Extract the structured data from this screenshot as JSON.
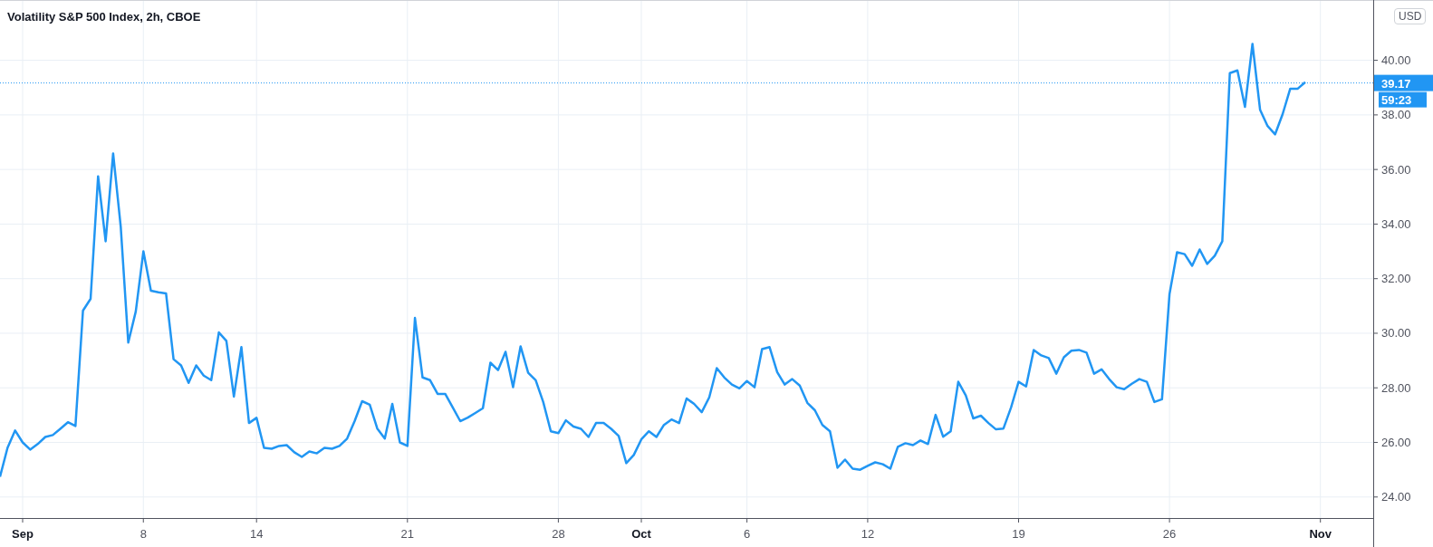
{
  "title": "Volatility S&P 500 Index, 2h, CBOE",
  "currency": "USD",
  "last_price": "39.17",
  "countdown": "59:23",
  "chart_data": {
    "type": "line",
    "grid": true,
    "ylim": [
      23.23,
      42.21
    ],
    "categories": [
      null,
      null,
      null,
      "Sep",
      null,
      null,
      null,
      null,
      null,
      null,
      null,
      null,
      null,
      null,
      null,
      null,
      null,
      null,
      null,
      "8",
      null,
      null,
      null,
      null,
      null,
      null,
      null,
      null,
      null,
      null,
      null,
      null,
      null,
      null,
      "14",
      null,
      null,
      null,
      null,
      null,
      null,
      null,
      null,
      null,
      null,
      null,
      null,
      null,
      null,
      null,
      null,
      null,
      null,
      null,
      "21",
      null,
      null,
      null,
      null,
      null,
      null,
      null,
      null,
      null,
      null,
      null,
      null,
      null,
      null,
      null,
      null,
      null,
      null,
      null,
      "28",
      null,
      null,
      null,
      null,
      null,
      null,
      null,
      null,
      null,
      null,
      "Oct",
      null,
      null,
      null,
      null,
      null,
      null,
      null,
      null,
      null,
      null,
      null,
      null,
      null,
      "6",
      null,
      null,
      null,
      null,
      null,
      null,
      null,
      null,
      null,
      null,
      null,
      null,
      null,
      null,
      null,
      "12",
      null,
      null,
      null,
      null,
      null,
      null,
      null,
      null,
      null,
      null,
      null,
      null,
      null,
      null,
      null,
      null,
      null,
      null,
      null,
      "19",
      null,
      null,
      null,
      null,
      null,
      null,
      null,
      null,
      null,
      null,
      null,
      null,
      null,
      null,
      null,
      null,
      null,
      null,
      null,
      "26",
      null,
      null,
      null,
      null,
      null,
      null,
      null,
      null,
      null,
      null,
      null,
      null,
      null,
      null,
      null,
      null,
      null,
      null,
      null,
      "Nov",
      null,
      null,
      null,
      null,
      null,
      null,
      null
    ],
    "ref_lines": [
      {
        "axis": "y",
        "value": 39.17,
        "color": "#2196f3"
      }
    ],
    "yticks": [
      {
        "value": 24,
        "label": "24.00"
      },
      {
        "value": 26,
        "label": "26.00"
      },
      {
        "value": 28,
        "label": "28.00"
      },
      {
        "value": 30,
        "label": "30.00"
      },
      {
        "value": 32,
        "label": "32.00"
      },
      {
        "value": 34,
        "label": "34.00"
      },
      {
        "value": 36,
        "label": "36.00"
      },
      {
        "value": 38,
        "label": "38.00"
      },
      {
        "value": 40,
        "label": "40.00"
      }
    ],
    "series": [
      {
        "color": "#2196f3",
        "values": [
          24.74,
          25.8,
          26.44,
          26.0,
          25.74,
          25.94,
          26.2,
          26.27,
          26.5,
          26.74,
          26.6,
          30.83,
          31.26,
          35.75,
          33.37,
          36.59,
          33.9,
          29.66,
          30.8,
          33.0,
          31.56,
          31.5,
          31.46,
          29.05,
          28.82,
          28.18,
          28.82,
          28.45,
          28.28,
          30.03,
          29.72,
          27.68,
          29.49,
          26.71,
          26.9,
          25.8,
          25.77,
          25.87,
          25.9,
          25.64,
          25.47,
          25.67,
          25.6,
          25.8,
          25.77,
          25.87,
          26.14,
          26.78,
          27.51,
          27.38,
          26.51,
          26.14,
          27.41,
          26.0,
          25.87,
          30.56,
          28.38,
          28.28,
          27.78,
          27.78,
          27.28,
          26.78,
          26.91,
          27.08,
          27.25,
          28.92,
          28.65,
          29.32,
          28.02,
          29.52,
          28.55,
          28.28,
          27.48,
          26.41,
          26.34,
          26.81,
          26.58,
          26.5,
          26.2,
          26.71,
          26.71,
          26.5,
          26.24,
          25.24,
          25.54,
          26.11,
          26.41,
          26.2,
          26.64,
          26.84,
          26.71,
          27.61,
          27.41,
          27.11,
          27.65,
          28.72,
          28.38,
          28.12,
          27.98,
          28.25,
          28.02,
          29.42,
          29.49,
          28.58,
          28.12,
          28.32,
          28.08,
          27.45,
          27.18,
          26.64,
          26.41,
          25.07,
          25.37,
          25.04,
          25.0,
          25.14,
          25.27,
          25.2,
          25.04,
          25.84,
          25.97,
          25.9,
          26.07,
          25.94,
          27.01,
          26.21,
          26.41,
          28.22,
          27.72,
          26.88,
          26.98,
          26.71,
          26.48,
          26.51,
          27.28,
          28.22,
          28.05,
          29.39,
          29.19,
          29.09,
          28.52,
          29.12,
          29.36,
          29.39,
          29.29,
          28.52,
          28.68,
          28.32,
          28.02,
          27.95,
          28.15,
          28.32,
          28.22,
          27.48,
          27.58,
          31.43,
          32.97,
          32.9,
          32.47,
          33.07,
          32.54,
          32.84,
          33.37,
          39.53,
          39.63,
          38.29,
          40.6,
          38.19,
          37.59,
          37.29,
          38.03,
          38.96,
          38.96,
          39.2,
          null,
          null,
          null,
          null,
          null,
          null,
          null,
          null,
          null
        ]
      }
    ]
  }
}
